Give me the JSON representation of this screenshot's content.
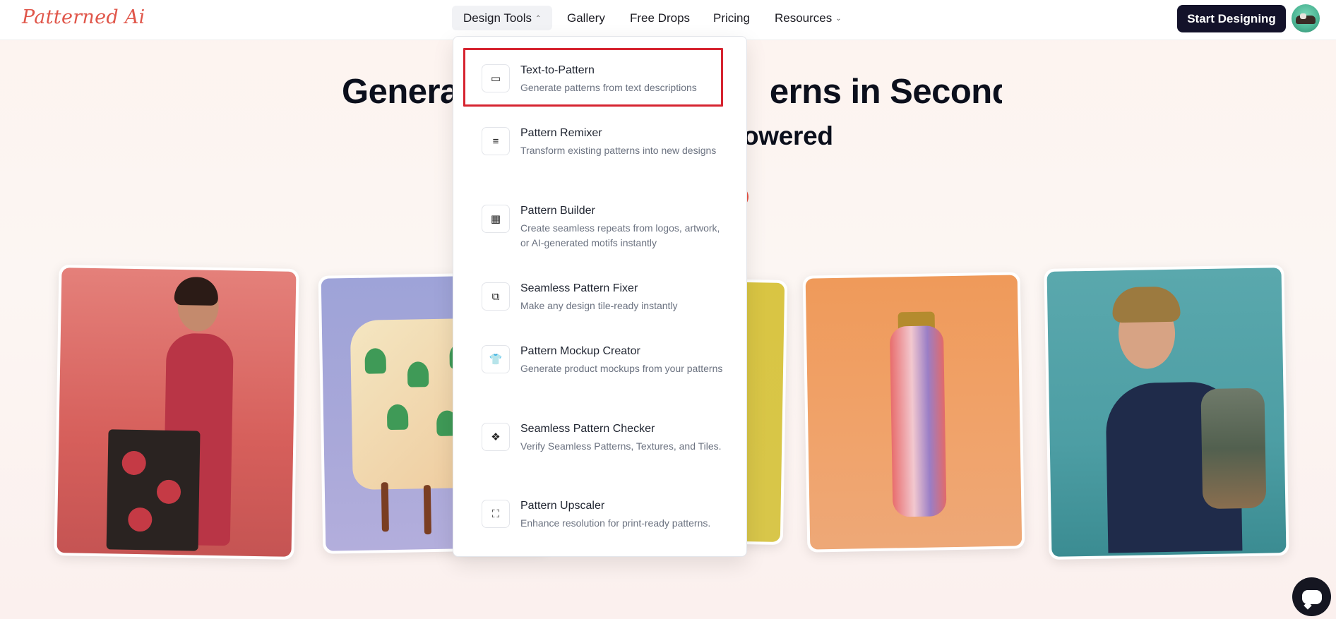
{
  "header": {
    "logo_text": "Patterned Ai",
    "nav": [
      {
        "label": "Design Tools",
        "chevron": "⌃",
        "active": true
      },
      {
        "label": "Gallery"
      },
      {
        "label": "Free Drops"
      },
      {
        "label": "Pricing"
      },
      {
        "label": "Resources",
        "chevron": "⌄"
      }
    ],
    "cta_label": "Start Designing"
  },
  "hero": {
    "title_left": "Genera",
    "title_right": "erns in Seconds",
    "subtitle_visible": "owered"
  },
  "dropdown": {
    "items": [
      {
        "title": "Text-to-Pattern",
        "description": "Generate patterns from text descriptions",
        "icon": "text-box-icon",
        "glyph": "▭",
        "highlighted": true
      },
      {
        "title": "Pattern Remixer",
        "description": "Transform existing patterns into new designs",
        "icon": "list-lines-icon",
        "glyph": "≡"
      },
      {
        "title": "Pattern Builder",
        "description": "Create seamless repeats from logos, artwork, or AI-generated motifs instantly",
        "icon": "grid-pattern-icon",
        "glyph": "▦"
      },
      {
        "title": "Seamless Pattern Fixer",
        "description": "Make any design tile-ready instantly",
        "icon": "tile-frame-icon",
        "glyph": "⧉"
      },
      {
        "title": "Pattern Mockup Creator",
        "description": "Generate product mockups from your patterns",
        "icon": "tshirt-icon",
        "glyph": "👕"
      },
      {
        "title": "Seamless Pattern Checker",
        "description": "Verify Seamless Patterns, Textures, and Tiles.",
        "icon": "diamond-dots-icon",
        "glyph": "❖"
      },
      {
        "title": "Pattern Upscaler",
        "description": "Enhance resolution for print-ready patterns.",
        "icon": "expand-arrows-icon",
        "glyph": "⛶"
      }
    ]
  },
  "colors": {
    "brand": "#e0564a",
    "cta_bg": "#13122a",
    "highlight": "#d62430"
  }
}
